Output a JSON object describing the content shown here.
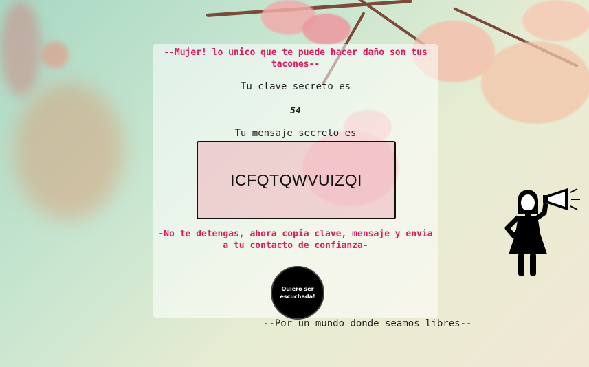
{
  "card": {
    "headline": "--Mujer! lo unico que te puede hacer daño son tus tacones--",
    "key_label": "Tu clave secreto es",
    "key_value": "54",
    "message_label": "Tu mensaje secreto es",
    "message_value": "ICFQTQWVUIZQI",
    "instruction": "-No te detengas, ahora copia clave, mensaje y envia a tu contacto de confianza-",
    "button_label": "Quiero ser escuchada!"
  },
  "footer": {
    "text": "--Por un mundo donde seamos libres--"
  },
  "icons": {
    "activist": "woman-megaphone-icon"
  },
  "colors": {
    "accent": "#e2185f",
    "button": "#000000"
  }
}
